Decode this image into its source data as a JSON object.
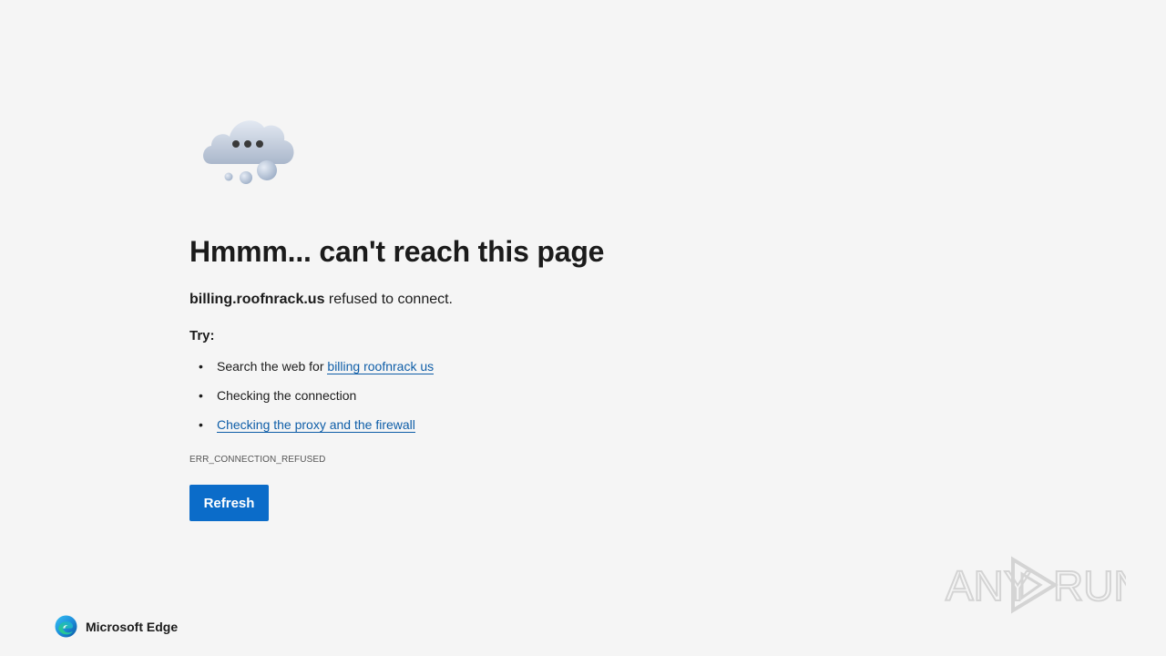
{
  "error": {
    "heading": "Hmmm... can't reach this page",
    "host": "billing.roofnrack.us",
    "reason_suffix": " refused to connect.",
    "try_label": "Try:",
    "suggestions": [
      {
        "prefix": "Search the web for ",
        "link": "billing roofnrack us"
      },
      {
        "text": "Checking the connection"
      },
      {
        "link": "Checking the proxy and the firewall"
      }
    ],
    "code": "ERR_CONNECTION_REFUSED",
    "refresh_label": "Refresh"
  },
  "brand": {
    "name": "Microsoft Edge",
    "icon": "edge-logo-icon"
  },
  "watermark": {
    "text_left": "ANY",
    "text_right": "RUN"
  },
  "colors": {
    "background": "#f5f5f5",
    "link": "#0f5ea8",
    "button": "#0b6cc9"
  }
}
